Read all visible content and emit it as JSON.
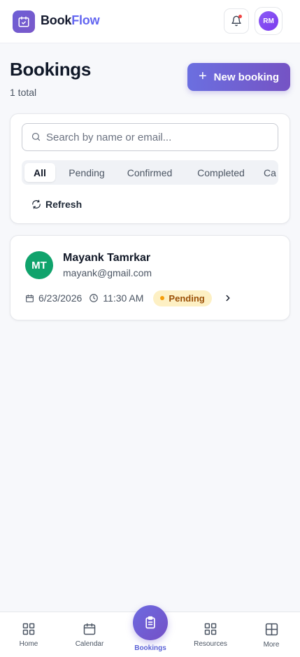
{
  "header": {
    "brand_part1": "Book",
    "brand_part2": "Flow",
    "avatar_initials": "RM"
  },
  "page": {
    "title": "Bookings",
    "total": "1 total",
    "new_booking_label": "New booking"
  },
  "search": {
    "placeholder": "Search by name or email...",
    "value": ""
  },
  "tabs": [
    {
      "label": "All",
      "active": true
    },
    {
      "label": "Pending"
    },
    {
      "label": "Confirmed"
    },
    {
      "label": "Completed"
    },
    {
      "label": "Ca"
    }
  ],
  "refresh_label": "Refresh",
  "booking": {
    "initials": "MT",
    "name": "Mayank Tamrkar",
    "email": "mayank@gmail.com",
    "date": "6/23/2026",
    "time": "11:30 AM",
    "status": "Pending"
  },
  "nav": {
    "home": "Home",
    "calendar": "Calendar",
    "bookings": "Bookings",
    "resources": "Resources",
    "more": "More"
  },
  "colors": {
    "accent": "#6366f1",
    "primary_gradient_start": "#6b6fe0",
    "primary_gradient_end": "#7553c4",
    "status_pending_bg": "#fdf0c4",
    "status_pending_text": "#9a4f06",
    "customer_avatar": "#10a36c"
  },
  "icons": {
    "logo": "calendar-check-icon",
    "notifications": "bell-icon",
    "search": "search-icon",
    "refresh": "refresh-icon",
    "date": "calendar-icon",
    "time": "clock-icon",
    "details": "chevron-right-icon",
    "home": "grid-icon",
    "calendar": "calendar-icon",
    "bookings": "clipboard-list-icon",
    "resources": "grid-icon",
    "more": "grid-plus-icon"
  }
}
